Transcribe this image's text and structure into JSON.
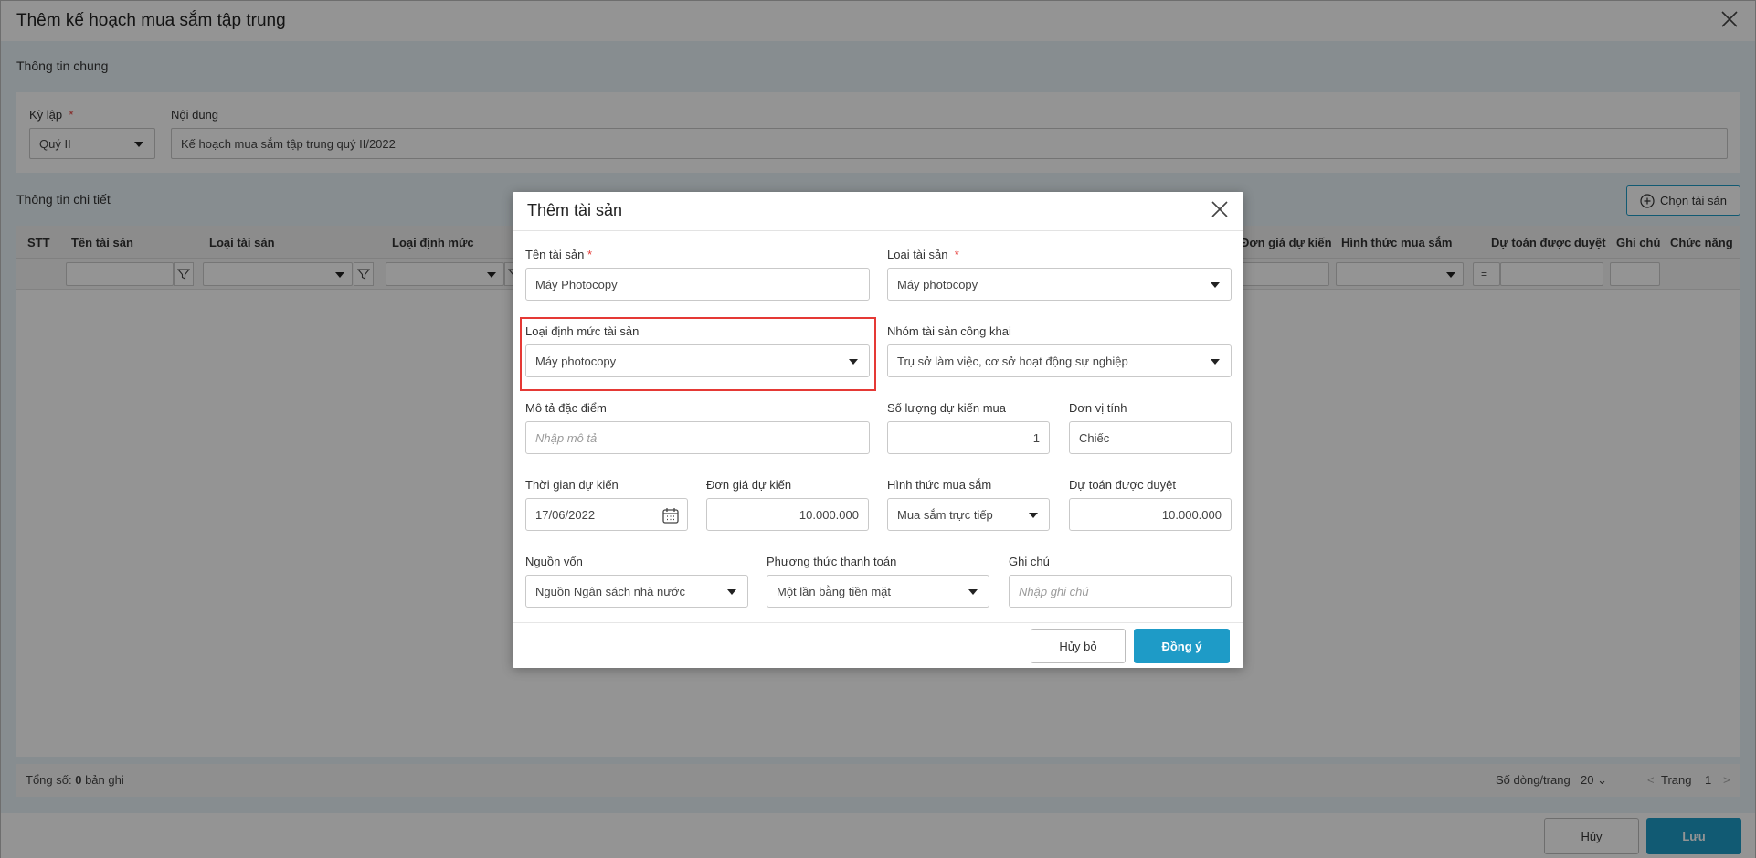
{
  "page": {
    "title": "Thêm kế hoạch mua sắm tập trung",
    "general_section": "Thông tin chung",
    "period_label": "Kỳ lập",
    "period_value": "Quý II",
    "content_label": "Nội dung",
    "content_value": "Kế hoạch mua sắm tập trung quý II/2022",
    "detail_section": "Thông tin chi tiết",
    "choose_asset_button": "Chọn tài sản",
    "grid_columns": [
      "STT",
      "Tên tài sản",
      "Loại tài sản",
      "Loại định mức",
      "Đơn giá dự kiến",
      "Hình thức mua sắm",
      "Dự toán được duyệt",
      "Ghi chú",
      "Chức năng"
    ],
    "filter_operator": "=",
    "total_label": "Tổng số:",
    "total_count": "0",
    "total_unit": "bản ghi",
    "rows_per_page_label": "Số dòng/trang",
    "rows_per_page_value": "20",
    "page_label": "Trang",
    "page_number": "1",
    "cancel_button": "Hủy",
    "save_button": "Lưu"
  },
  "modal": {
    "title": "Thêm tài sản",
    "asset_name_label": "Tên tài sản",
    "asset_name_value": "Máy Photocopy",
    "asset_type_label": "Loại tài sản",
    "asset_type_value": "Máy photocopy",
    "norm_type_label": "Loại định mức tài sản",
    "norm_type_value": "Máy photocopy",
    "public_group_label": "Nhóm tài sản công khai",
    "public_group_value": "Trụ sở làm việc, cơ sở hoạt động sự nghiệp",
    "description_label": "Mô tả đặc điểm",
    "description_placeholder": "Nhập mô tả",
    "quantity_label": "Số lượng dự kiến mua",
    "quantity_value": "1",
    "unit_label": "Đơn vị tính",
    "unit_value": "Chiếc",
    "expected_time_label": "Thời gian dự kiến",
    "expected_time_value": "17/06/2022",
    "unit_price_label": "Đơn giá dự kiến",
    "unit_price_value": "10.000.000",
    "purchase_method_label": "Hình thức mua sắm",
    "purchase_method_value": "Mua sắm trực tiếp",
    "approved_budget_label": "Dự toán được duyệt",
    "approved_budget_value": "10.000.000",
    "fund_source_label": "Nguồn vốn",
    "fund_source_value": "Nguồn Ngân sách nhà nước",
    "payment_method_label": "Phương thức thanh toán",
    "payment_method_value": "Một lần bằng tiền mặt",
    "note_label": "Ghi chú",
    "note_placeholder": "Nhập ghi chú",
    "required_mark": "*",
    "cancel_button": "Hủy bỏ",
    "ok_button": "Đồng ý"
  },
  "colors": {
    "accent": "#1e9bc7",
    "highlight_border": "#e53935"
  }
}
